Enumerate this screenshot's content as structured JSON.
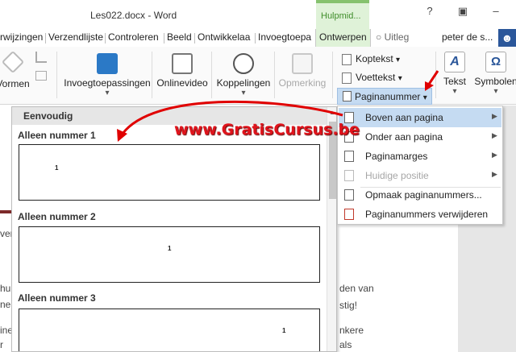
{
  "window": {
    "title": "Les022.docx - Word",
    "context_tab": "Hulpmid...",
    "controls": {
      "help": "?",
      "restore": "▣",
      "minimize": "–"
    }
  },
  "tabs": {
    "items": [
      "rwijzingen",
      "Verzendlijste",
      "Controleren",
      "Beeld",
      "Ontwikkelaa",
      "Invoegtoepa",
      "Ontwerpen"
    ],
    "active": "Ontwerpen",
    "help": "Uitleg",
    "user": "peter de s...",
    "share_icon": "person-plus-icon"
  },
  "ribbon": {
    "vormen": "Vormen",
    "invoeg": "Invoegtoepassingen",
    "onlinevideo": "Onlinevideo",
    "koppelingen": "Koppelingen",
    "opmerking": "Opmerking",
    "koptekst": "Koptekst",
    "voettekst": "Voettekst",
    "paginanummer": "Paginanummer",
    "tekst": "Tekst",
    "symbolen": "Symbolen",
    "dropdown_glyph": "▾"
  },
  "gallery": {
    "header": "Eenvoudig",
    "items": [
      {
        "title": "Alleen nummer 1",
        "num": "1"
      },
      {
        "title": "Alleen nummer 2",
        "num": "1"
      },
      {
        "title": "Alleen nummer 3",
        "num": "1"
      }
    ]
  },
  "submenu": {
    "items": [
      {
        "label": "Boven aan pagina",
        "hover": true,
        "disabled": false,
        "arrow": "▶"
      },
      {
        "label": "Onder aan pagina",
        "hover": false,
        "disabled": false,
        "arrow": "▶"
      },
      {
        "label": "Paginamarges",
        "hover": false,
        "disabled": false,
        "arrow": "▶"
      },
      {
        "label": "Huidige positie",
        "hover": false,
        "disabled": true,
        "arrow": "▶"
      },
      {
        "label": "Opmaak paginanummers...",
        "hover": false,
        "disabled": false,
        "arrow": ""
      },
      {
        "label": "Paginanummers verwijderen",
        "hover": false,
        "disabled": false,
        "arrow": ""
      }
    ]
  },
  "document": {
    "line1": "ver",
    "line2a": "hui",
    "line2b": "ne",
    "line3a": "ine",
    "line3b": "r",
    "right1": "den van",
    "right2": "stig!",
    "right3": "nkere",
    "right4": "als"
  },
  "watermark": "www.GratisCursus.be",
  "colors": {
    "accent": "#2b579a",
    "context": "#dff2d8",
    "hover": "#c5dbf2",
    "watermark": "#e0141c"
  }
}
